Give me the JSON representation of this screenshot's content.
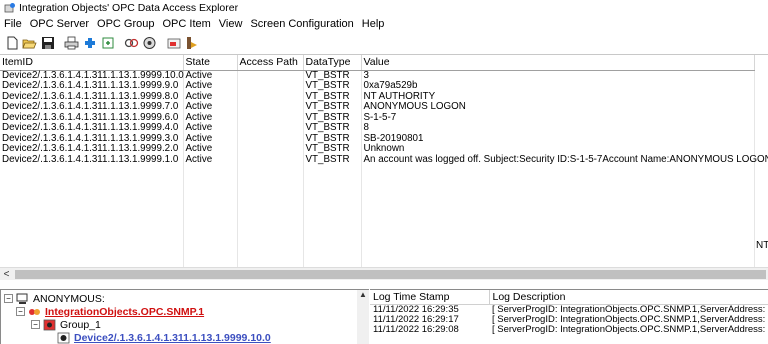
{
  "window": {
    "title": "Integration Objects' OPC Data Access Explorer"
  },
  "menu": [
    "File",
    "OPC Server",
    "OPC Group",
    "OPC Item",
    "View",
    "Screen Configuration",
    "Help"
  ],
  "grid": {
    "columns": [
      "ItemID",
      "State",
      "Access Path",
      "DataType",
      "Value"
    ],
    "rows": [
      [
        "Device2/.1.3.6.1.4.1.311.1.13.1.9999.10.0",
        "Active",
        "",
        "VT_BSTR",
        "3"
      ],
      [
        "Device2/.1.3.6.1.4.1.311.1.13.1.9999.9.0",
        "Active",
        "",
        "VT_BSTR",
        "0xa79a529b"
      ],
      [
        "Device2/.1.3.6.1.4.1.311.1.13.1.9999.8.0",
        "Active",
        "",
        "VT_BSTR",
        "NT AUTHORITY"
      ],
      [
        "Device2/.1.3.6.1.4.1.311.1.13.1.9999.7.0",
        "Active",
        "",
        "VT_BSTR",
        "ANONYMOUS LOGON"
      ],
      [
        "Device2/.1.3.6.1.4.1.311.1.13.1.9999.6.0",
        "Active",
        "",
        "VT_BSTR",
        "S-1-5-7"
      ],
      [
        "Device2/.1.3.6.1.4.1.311.1.13.1.9999.4.0",
        "Active",
        "",
        "VT_BSTR",
        "8"
      ],
      [
        "Device2/.1.3.6.1.4.1.311.1.13.1.9999.3.0",
        "Active",
        "",
        "VT_BSTR",
        "SB-20190801"
      ],
      [
        "Device2/.1.3.6.1.4.1.311.1.13.1.9999.2.0",
        "Active",
        "",
        "VT_BSTR",
        "Unknown"
      ],
      [
        "Device2/.1.3.6.1.4.1.311.1.13.1.9999.1.0",
        "Active",
        "",
        "VT_BSTR",
        "An account was logged off. Subject:Security ID:S-1-5-7Account Name:ANONYMOUS LOGONAc"
      ]
    ],
    "overflow_fragment": "NT A"
  },
  "tree": {
    "root": "ANONYMOUS:",
    "server": "IntegrationObjects.OPC.SNMP.1",
    "group": "Group_1",
    "item": "Device2/.1.3.6.1.4.1.311.1.13.1.9999.10.0"
  },
  "log": {
    "columns": [
      "Log Time Stamp",
      "Log Description"
    ],
    "rows": [
      [
        "11/11/2022 16:29:35",
        "[ ServerProgID: IntegrationObjects.OPC.SNMP.1,ServerAddress: S"
      ],
      [
        "11/11/2022 16:29:17",
        "[ ServerProgID: IntegrationObjects.OPC.SNMP.1,ServerAddress: S"
      ],
      [
        "11/11/2022 16:29:08",
        "[ ServerProgID: IntegrationObjects.OPC.SNMP.1,ServerAddress: S"
      ]
    ]
  },
  "icons": {
    "toolbar": [
      "new-icon",
      "open-icon",
      "save-icon",
      "print-icon",
      "add-icon",
      "add-group-icon",
      "connect-icon",
      "browse-icon",
      "properties-icon",
      "write-icon"
    ]
  },
  "colors": {
    "server_link": "#d01010",
    "item_link": "#3c4fc0"
  }
}
